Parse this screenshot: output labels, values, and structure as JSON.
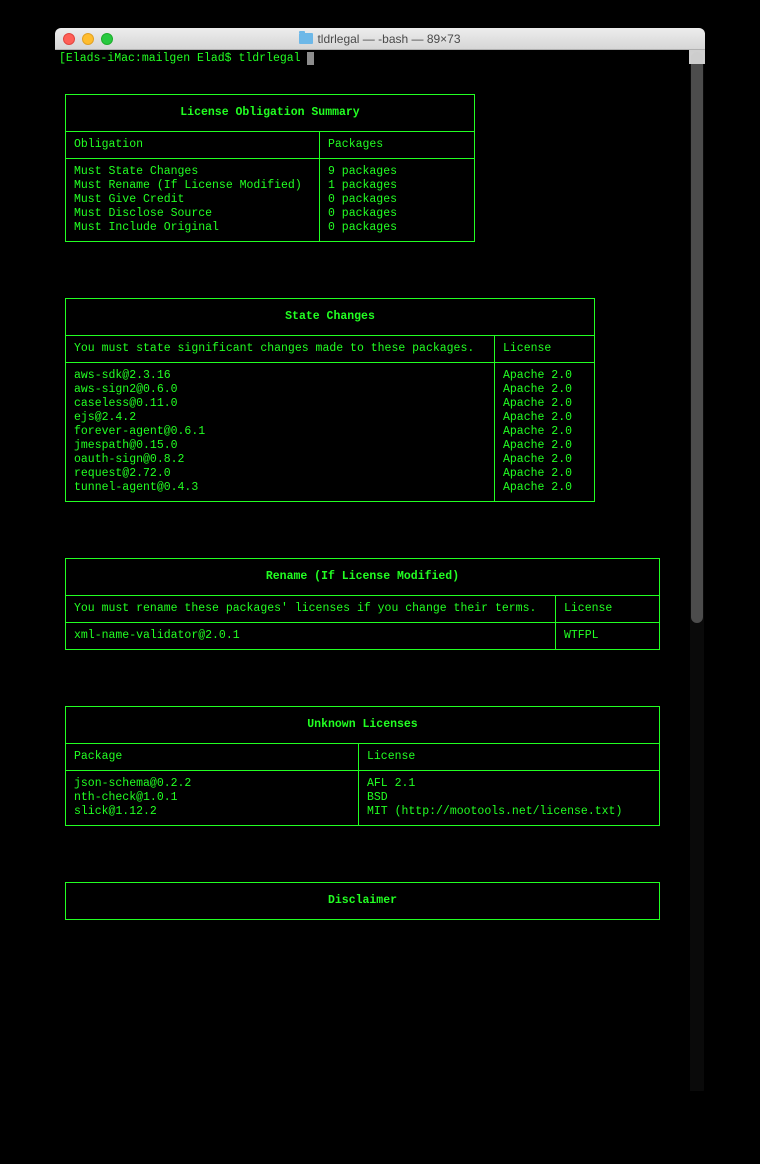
{
  "window": {
    "title": "tldrlegal — -bash — 89×73"
  },
  "prompt": {
    "host": "Elads-iMac:mailgen Elad$",
    "command": "tldrlegal"
  },
  "summary": {
    "title": "License Obligation Summary",
    "headers": {
      "c1": "Obligation",
      "c2": "Packages"
    },
    "rows": [
      {
        "c1": "Must State Changes",
        "c2": "9 packages"
      },
      {
        "c1": "Must Rename (If License Modified)",
        "c2": "1 packages"
      },
      {
        "c1": "Must Give Credit",
        "c2": "0 packages"
      },
      {
        "c1": "Must Disclose Source",
        "c2": "0 packages"
      },
      {
        "c1": "Must Include Original",
        "c2": "0 packages"
      }
    ]
  },
  "state": {
    "title": "State Changes",
    "headers": {
      "c1": "You must state significant changes made to these packages.",
      "c2": "License"
    },
    "rows": [
      {
        "c1": "aws-sdk@2.3.16",
        "c2": "Apache 2.0"
      },
      {
        "c1": "aws-sign2@0.6.0",
        "c2": "Apache 2.0"
      },
      {
        "c1": "caseless@0.11.0",
        "c2": "Apache 2.0"
      },
      {
        "c1": "ejs@2.4.2",
        "c2": "Apache 2.0"
      },
      {
        "c1": "forever-agent@0.6.1",
        "c2": "Apache 2.0"
      },
      {
        "c1": "jmespath@0.15.0",
        "c2": "Apache 2.0"
      },
      {
        "c1": "oauth-sign@0.8.2",
        "c2": "Apache 2.0"
      },
      {
        "c1": "request@2.72.0",
        "c2": "Apache 2.0"
      },
      {
        "c1": "tunnel-agent@0.4.3",
        "c2": "Apache 2.0"
      }
    ]
  },
  "rename": {
    "title": "Rename (If License Modified)",
    "headers": {
      "c1": "You must rename these packages' licenses if you change their terms.",
      "c2": "License"
    },
    "rows": [
      {
        "c1": "xml-name-validator@2.0.1",
        "c2": "WTFPL"
      }
    ]
  },
  "unknown": {
    "title": "Unknown Licenses",
    "headers": {
      "c1": "Package",
      "c2": "License"
    },
    "rows": [
      {
        "c1": "json-schema@0.2.2",
        "c2": "AFL 2.1"
      },
      {
        "c1": "nth-check@1.0.1",
        "c2": "BSD"
      },
      {
        "c1": "slick@1.12.2",
        "c2": "MIT (http://mootools.net/license.txt)"
      }
    ]
  },
  "disclaimer": {
    "title": "Disclaimer"
  }
}
